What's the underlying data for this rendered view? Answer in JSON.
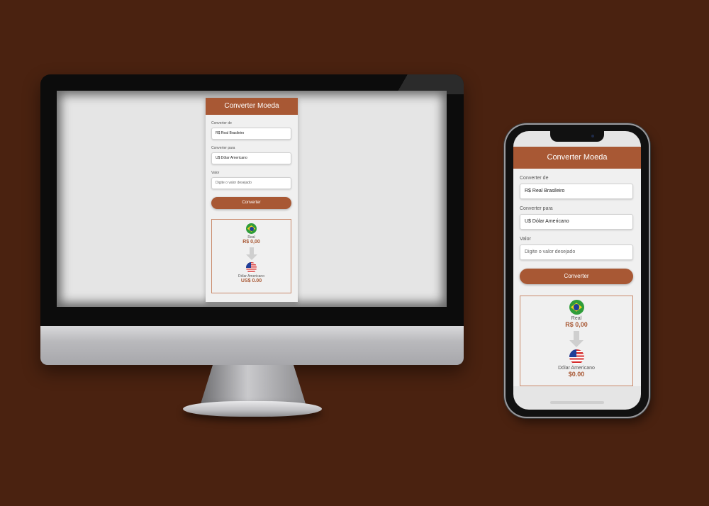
{
  "app": {
    "title": "Converter Moeda"
  },
  "desktop": {
    "from_label": "Converter de",
    "from_value": "R$ Real Brasileiro",
    "to_label": "Converter para",
    "to_value": "U$ Dólar Americano",
    "amount_label": "Valor",
    "amount_placeholder": "Digite o valor desejado",
    "button_label": "Converter",
    "source_currency_name": "Real",
    "source_amount": "R$ 0,00",
    "target_currency_name": "Dólar Americano",
    "target_amount": "US$ 0.00"
  },
  "mobile": {
    "from_label": "Converter de",
    "from_value": "R$ Real Brasileiro",
    "to_label": "Converter para",
    "to_value": "U$ Dólar Americano",
    "amount_label": "Valor",
    "amount_placeholder": "Digite o valor desejado",
    "button_label": "Converter",
    "source_currency_name": "Real",
    "source_amount": "R$ 0,00",
    "target_currency_name": "Dólar Americano",
    "target_amount": "$0.00"
  },
  "colors": {
    "accent": "#a85834",
    "background": "#4a2210",
    "card": "#f0f0f0"
  },
  "icons": {
    "source_flag": "brazil-flag-icon",
    "target_flag": "usa-flag-icon",
    "arrow": "arrow-down-icon"
  }
}
